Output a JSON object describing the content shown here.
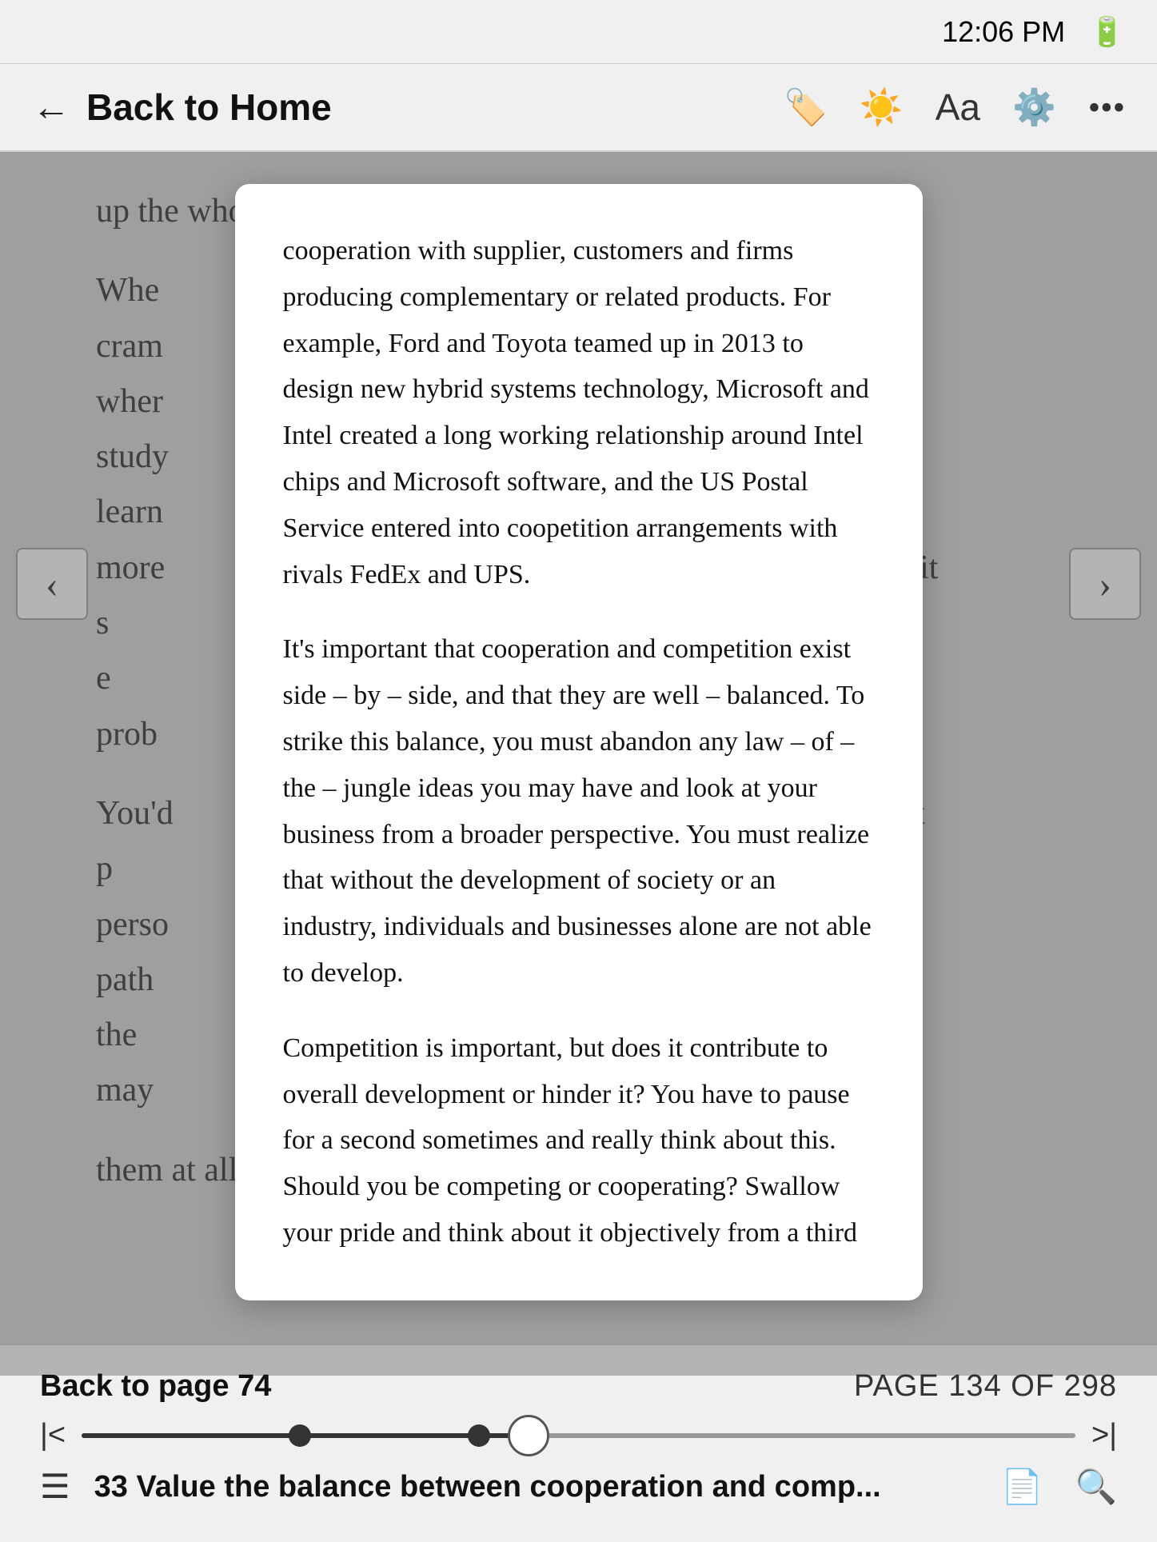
{
  "statusBar": {
    "time": "12:06 PM",
    "battery": "🔋"
  },
  "navBar": {
    "backLabel": "Back to Home",
    "icons": {
      "bookmark": "bookmark-icon",
      "brightness": "brightness-icon",
      "font": "font-icon",
      "settings": "settings-icon",
      "more": "more-icon"
    }
  },
  "backgroundText": {
    "line1": "up the whole night before.",
    "paragraph1": "Whe... cram... wher... that study... h, learn... uch more... ople quit s... e a test e... prob...",
    "paragraph2": "You'c... o's quit p... eir perso... path... ing is the... ome may... ed them at all in their working lives. But the reason it"
  },
  "popup": {
    "paragraphs": [
      "cooperation with supplier, customers and firms producing complementary or related products. For example, Ford and Toyota teamed up in 2013 to design new hybrid systems technology, Microsoft and Intel created a long working relationship around Intel chips and Microsoft software, and the US Postal Service entered into coopetition arrangements with rivals FedEx and UPS.",
      "It's important that cooperation and competition exist side – by – side, and that they are well – balanced. To strike this balance, you must abandon any law – of – the – jungle ideas you may have and look at your business from a broader perspective. You must realize that without the development of society or an industry, individuals and businesses alone are not able to develop.",
      "Competition is important, but does it contribute to overall development or hinder it? You have to pause for a second sometimes and really think about this. Should you be competing or cooperating? Swallow your pride and think about it objectively from a third"
    ]
  },
  "bottomBar": {
    "backToPage": "Back to page 74",
    "pageInfo": "PAGE 134 OF 298",
    "progressPercent": 45,
    "chapterText": "33 Value the balance between cooperation and comp...",
    "firstEdgeBtn": "|<",
    "lastEdgeBtn": ">|"
  }
}
